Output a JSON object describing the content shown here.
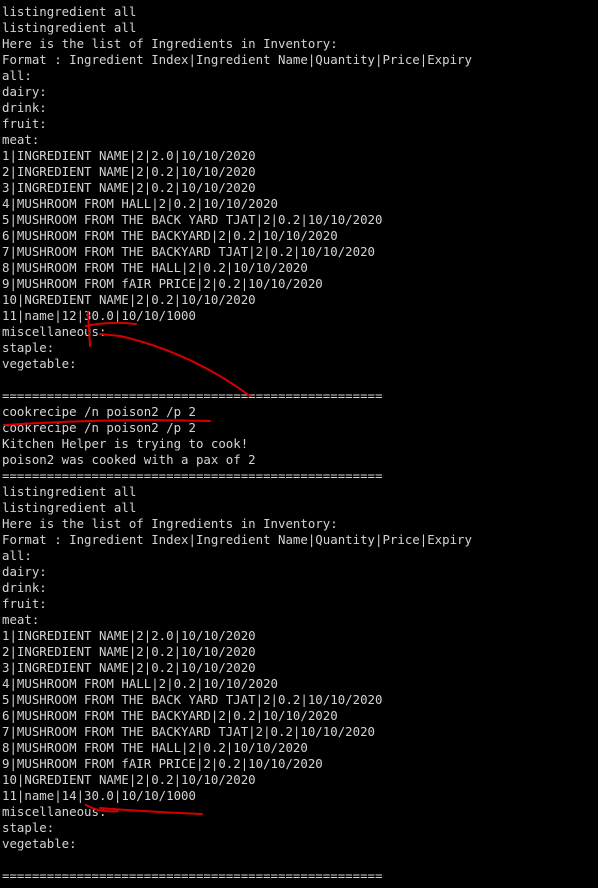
{
  "terminal": {
    "background": "#000000",
    "text_color": "#d4d4d4",
    "annotation_color": "#d40000",
    "lines": [
      "listingredient all",
      "listingredient all",
      "Here is the list of Ingredients in Inventory:",
      "Format : Ingredient Index|Ingredient Name|Quantity|Price|Expiry",
      "all:",
      "dairy:",
      "drink:",
      "fruit:",
      "meat:",
      "1|INGREDIENT NAME|2|2.0|10/10/2020",
      "2|INGREDIENT NAME|2|0.2|10/10/2020",
      "3|INGREDIENT NAME|2|0.2|10/10/2020",
      "4|MUSHROOM FROM HALL|2|0.2|10/10/2020",
      "5|MUSHROOM FROM THE BACK YARD TJAT|2|0.2|10/10/2020",
      "6|MUSHROOM FROM THE BACKYARD|2|0.2|10/10/2020",
      "7|MUSHROOM FROM THE BACKYARD TJAT|2|0.2|10/10/2020",
      "8|MUSHROOM FROM THE HALL|2|0.2|10/10/2020",
      "9|MUSHROOM FROM fAIR PRICE|2|0.2|10/10/2020",
      "10|NGREDIENT NAME|2|0.2|10/10/2020",
      "11|name|12|30.0|10/10/1000",
      "miscellaneous:",
      "staple:",
      "vegetable:",
      "",
      "===================================================",
      "cookrecipe /n poison2 /p 2",
      "cookrecipe /n poison2 /p 2",
      "Kitchen Helper is trying to cook!",
      "poison2 was cooked with a pax of 2",
      "===================================================",
      "listingredient all",
      "listingredient all",
      "Here is the list of Ingredients in Inventory:",
      "Format : Ingredient Index|Ingredient Name|Quantity|Price|Expiry",
      "all:",
      "dairy:",
      "drink:",
      "fruit:",
      "meat:",
      "1|INGREDIENT NAME|2|2.0|10/10/2020",
      "2|INGREDIENT NAME|2|0.2|10/10/2020",
      "3|INGREDIENT NAME|2|0.2|10/10/2020",
      "4|MUSHROOM FROM HALL|2|0.2|10/10/2020",
      "5|MUSHROOM FROM THE BACK YARD TJAT|2|0.2|10/10/2020",
      "6|MUSHROOM FROM THE BACKYARD|2|0.2|10/10/2020",
      "7|MUSHROOM FROM THE BACKYARD TJAT|2|0.2|10/10/2020",
      "8|MUSHROOM FROM THE HALL|2|0.2|10/10/2020",
      "9|MUSHROOM FROM fAIR PRICE|2|0.2|10/10/2020",
      "10|NGREDIENT NAME|2|0.2|10/10/2020",
      "11|name|14|30.0|10/10/1000",
      "miscellaneous:",
      "staple:",
      "vegetable:",
      "",
      "==================================================="
    ]
  }
}
